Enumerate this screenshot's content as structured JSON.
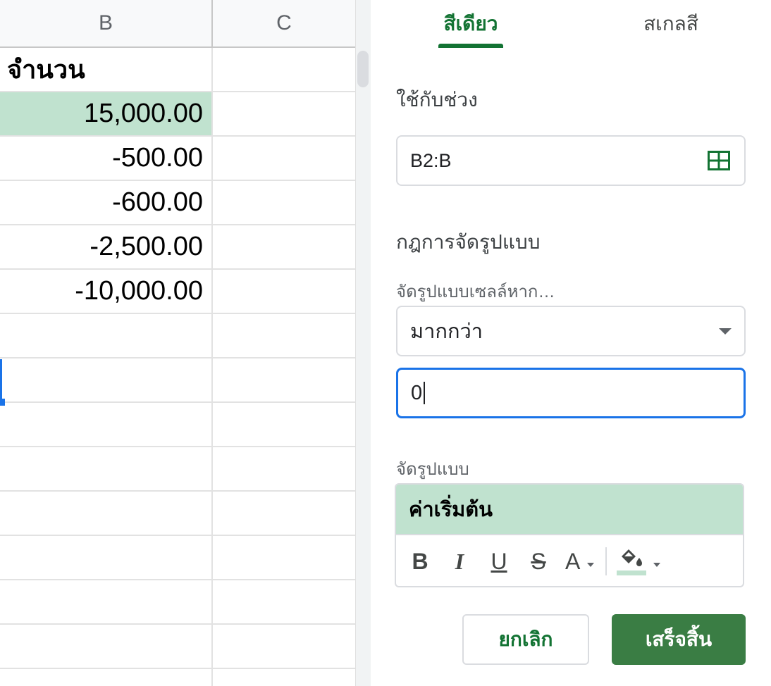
{
  "sheet": {
    "columns": [
      "B",
      "C"
    ],
    "header_cell": "จำนวน",
    "values": [
      "15,000.00",
      "-500.00",
      "-600.00",
      "-2,500.00",
      "-10,000.00"
    ],
    "highlight_color": "#c0e2cf",
    "selection_color": "#1a73e8"
  },
  "panel": {
    "tabs": {
      "single_color": "สีเดียว",
      "color_scale": "สเกลสี"
    },
    "apply_to_range_label": "ใช้กับช่วง",
    "range_value": "B2:B",
    "format_rules_label": "กฎการจัดรูปแบบ",
    "format_cells_if_label": "จัดรูปแบบเซลล์หาก…",
    "condition_value": "มากกว่า",
    "condition_input_value": "0",
    "formatting_style_label": "จัดรูปแบบ",
    "preview_text": "ค่าเริ่มต้น",
    "toolbar": {
      "bold": "B",
      "italic": "I",
      "underline": "U",
      "strikethrough": "S",
      "text_color": "A"
    },
    "cancel_label": "ยกเลิก",
    "done_label": "เสร็จสิ้น",
    "accent_color": "#137333",
    "done_color": "#3a7d44",
    "fill_color": "#c0e2cf"
  }
}
